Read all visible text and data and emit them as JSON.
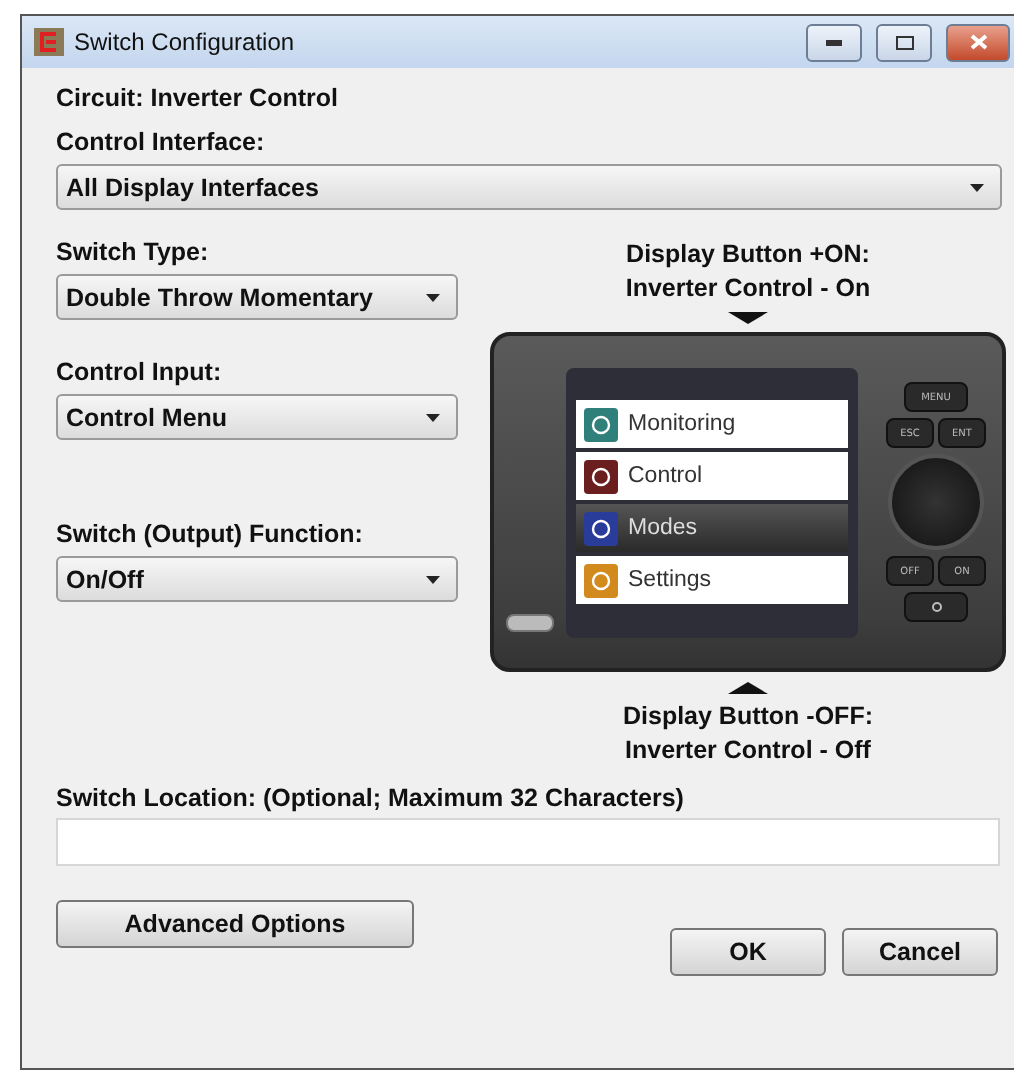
{
  "window": {
    "title": "Switch Configuration"
  },
  "circuit": "Circuit: Inverter Control",
  "control_interface": {
    "label": "Control Interface:",
    "value": "All Display Interfaces"
  },
  "switch_type": {
    "label": "Switch Type:",
    "value": "Double Throw Momentary"
  },
  "control_input": {
    "label": "Control Input:",
    "value": "Control Menu"
  },
  "switch_function": {
    "label": "Switch (Output) Function:",
    "value": "On/Off"
  },
  "display_top": [
    "Display Button +ON:",
    "Inverter Control - On"
  ],
  "display_menu": [
    {
      "label": "Monitoring",
      "kind": "monitoring",
      "selected": false
    },
    {
      "label": "Control",
      "kind": "control",
      "selected": false
    },
    {
      "label": "Modes",
      "kind": "modes",
      "selected": true
    },
    {
      "label": "Settings",
      "kind": "settings",
      "selected": false
    }
  ],
  "device_keys": {
    "menu": "MENU",
    "esc": "ESC",
    "ent": "ENT",
    "off": "OFF",
    "on": "ON"
  },
  "display_bottom": [
    "Display Button -OFF:",
    "Inverter Control - Off"
  ],
  "switch_location": {
    "label": "Switch Location: (Optional; Maximum 32 Characters)"
  },
  "buttons": {
    "advanced": "Advanced Options",
    "ok": "OK",
    "cancel": "Cancel"
  }
}
